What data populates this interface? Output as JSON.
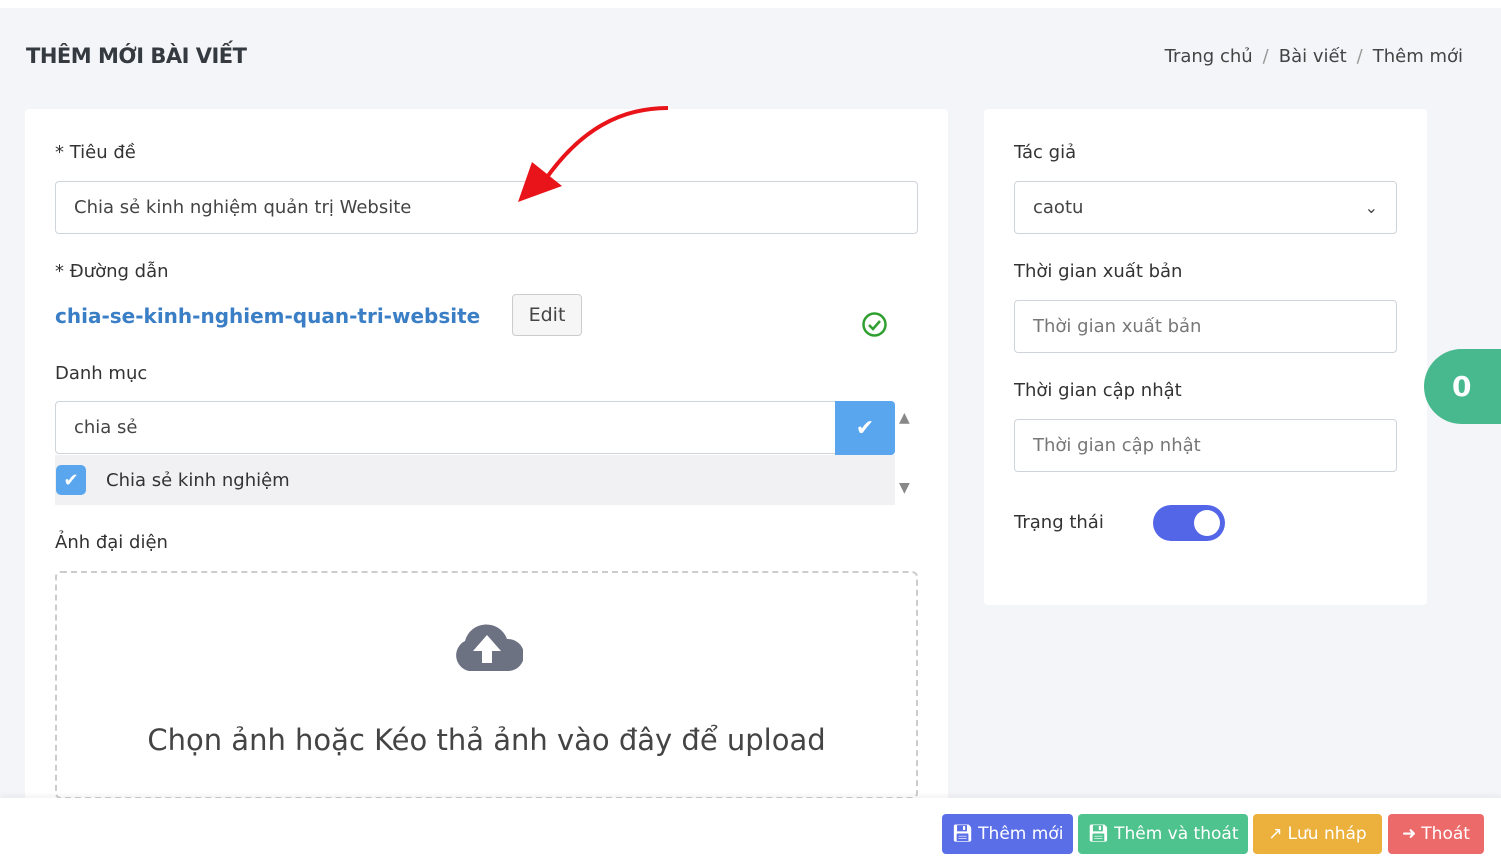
{
  "header": {
    "title": "THÊM MỚI BÀI VIẾT",
    "breadcrumb": [
      "Trang chủ",
      "Bài viết",
      "Thêm mới"
    ]
  },
  "form": {
    "title_label": "* Tiêu đề",
    "title_value": "Chia sẻ kinh nghiệm quản trị Website",
    "slug_label": "* Đường dẫn",
    "slug_value": "chia-se-kinh-nghiem-quan-tri-website",
    "edit_label": "Edit",
    "category_label": "Danh mục",
    "category_search": "chia sẻ",
    "category_option": "Chia sẻ kinh nghiệm",
    "category_checked": true,
    "image_label": "Ảnh đại diện",
    "upload_text": "Chọn ảnh hoặc Kéo thả ảnh vào đây để upload"
  },
  "side": {
    "author_label": "Tác giả",
    "author_value": "caotu",
    "publish_label": "Thời gian xuất bản",
    "publish_placeholder": "Thời gian xuất bản",
    "update_label": "Thời gian cập nhật",
    "update_placeholder": "Thời gian cập nhật",
    "status_label": "Trạng thái",
    "status_on": true
  },
  "badge": "0",
  "footer": {
    "add": "Thêm mới",
    "add_exit": "Thêm và thoát",
    "draft": "Lưu nháp",
    "exit": "Thoát"
  },
  "colors": {
    "add": "#5a6ee8",
    "add_exit": "#4fc38e",
    "draft": "#ebb13c",
    "exit": "#ec6a6a",
    "annotation_arrow": "#e8141a"
  }
}
